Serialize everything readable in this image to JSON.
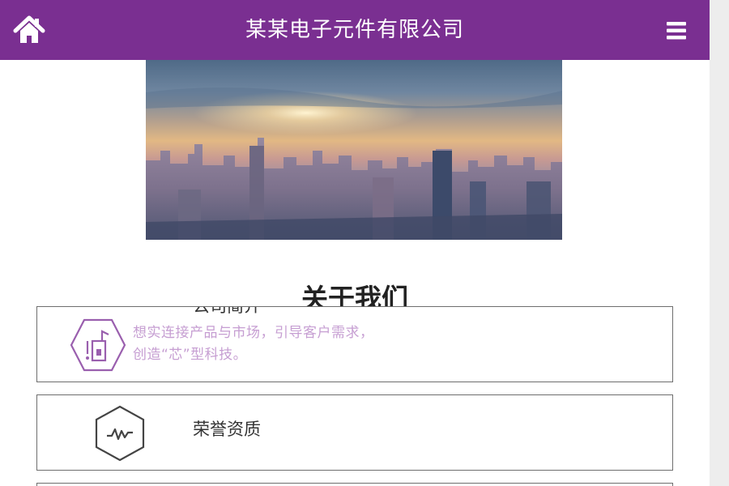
{
  "header": {
    "title": "某某电子元件有限公司",
    "home_icon": "home-icon",
    "menu_icon": "hamburger-menu-icon",
    "background_color": "#7a2f91"
  },
  "banner": {
    "description": "city-skyline-sunrise-photo"
  },
  "about": {
    "heading": "关于我们",
    "cards": [
      {
        "title": "公司简介",
        "description": "想实连接产品与市场，引导客户需求，创造“芯”型科技。",
        "icon": "hexagon-chip-icon"
      },
      {
        "title": "荣誉资质",
        "description": "",
        "icon": "hexagon-pulse-icon"
      }
    ]
  },
  "colors": {
    "accent": "#7a2f91",
    "desc_text": "#c69ed2",
    "card_border": "#6e6e6e"
  }
}
